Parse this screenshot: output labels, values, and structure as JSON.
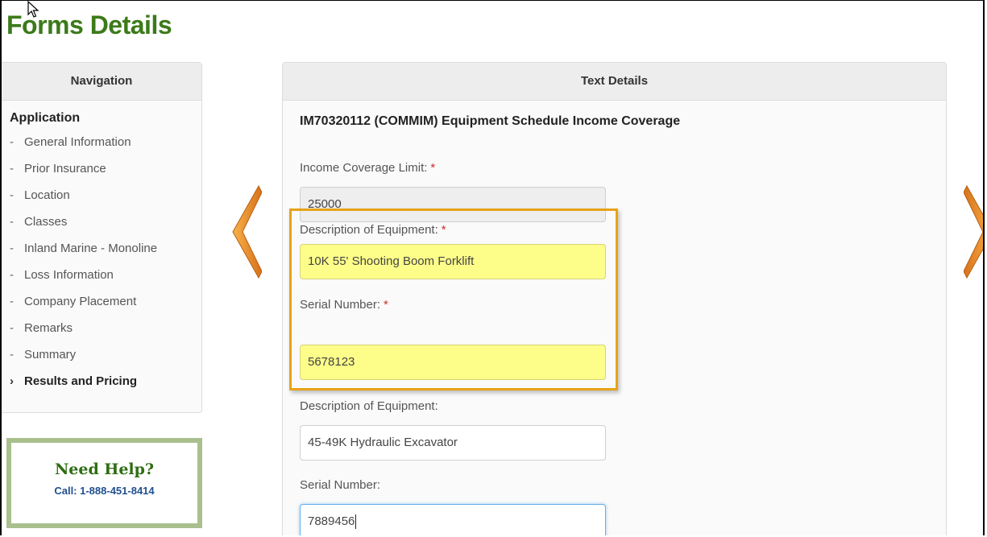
{
  "page": {
    "title": "Forms Details"
  },
  "navigation": {
    "header": "Navigation",
    "section": "Application",
    "items": [
      {
        "label": "General Information",
        "prefix": "-"
      },
      {
        "label": "Prior Insurance",
        "prefix": "-"
      },
      {
        "label": "Location",
        "prefix": "-"
      },
      {
        "label": "Classes",
        "prefix": "-"
      },
      {
        "label": "Inland Marine - Monoline",
        "prefix": "-"
      },
      {
        "label": "Loss Information",
        "prefix": "-"
      },
      {
        "label": "Company Placement",
        "prefix": "-"
      },
      {
        "label": "Remarks",
        "prefix": "-"
      },
      {
        "label": "Summary",
        "prefix": "-"
      },
      {
        "label": "Results and Pricing",
        "prefix": "›"
      }
    ]
  },
  "help": {
    "title": "Need Help?",
    "call": "Call: 1-888-451-8414"
  },
  "details": {
    "header": "Text Details",
    "form_name": "IM70320112 (COMMIM) Equipment Schedule Income Coverage",
    "income_limit": {
      "label": "Income Coverage Limit:",
      "required": "*",
      "value": "25000"
    },
    "equipment_1": {
      "label": "Description of Equipment:",
      "required": "*",
      "value": "10K 55' Shooting Boom Forklift"
    },
    "serial_1": {
      "label": "Serial Number:",
      "required": "*",
      "value": "5678123"
    },
    "equipment_2": {
      "label": "Description of Equipment:",
      "value": "45-49K Hydraulic Excavator"
    },
    "serial_2": {
      "label": "Serial Number:",
      "value": "7889456"
    }
  },
  "colors": {
    "title_green": "#3c7a1a",
    "arrow_orange": "#e8901c",
    "highlight_border": "#e8a317",
    "highlight_fill": "#fdfd8a",
    "help_border": "#a9c08e",
    "required_red": "#c9302c"
  },
  "icons": [
    "mouse-cursor-icon",
    "chevron-left-icon",
    "chevron-right-icon"
  ]
}
